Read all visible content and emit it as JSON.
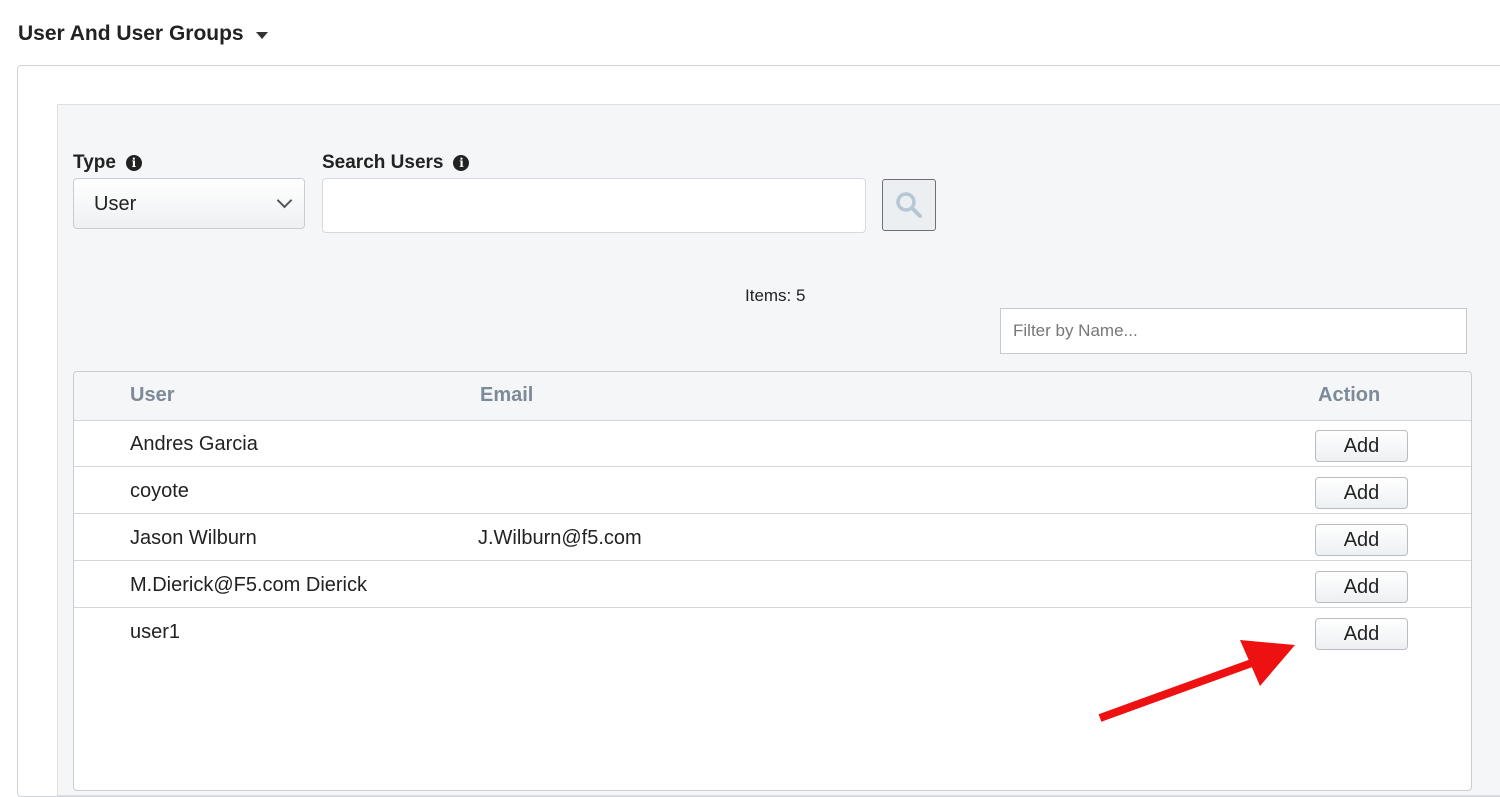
{
  "section": {
    "title": "User And User Groups"
  },
  "type_field": {
    "label": "Type",
    "value": "User"
  },
  "search_field": {
    "label": "Search Users",
    "value": ""
  },
  "items": {
    "text": "Items: 5"
  },
  "filter": {
    "placeholder": "Filter by Name..."
  },
  "table": {
    "headers": {
      "user": "User",
      "email": "Email",
      "action": "Action"
    },
    "rows": [
      {
        "user": "Andres Garcia",
        "email": "",
        "action": "Add"
      },
      {
        "user": "coyote",
        "email": "",
        "action": "Add"
      },
      {
        "user": "Jason Wilburn",
        "email": "J.Wilburn@f5.com",
        "action": "Add"
      },
      {
        "user": "M.Dierick@F5.com Dierick",
        "email": "",
        "action": "Add"
      },
      {
        "user": "user1",
        "email": "",
        "action": "Add"
      }
    ]
  },
  "annotation": {
    "arrow_color": "#ee1111"
  },
  "icons": {
    "info": "info-icon",
    "search": "search-icon",
    "caret": "caret-down-icon"
  }
}
